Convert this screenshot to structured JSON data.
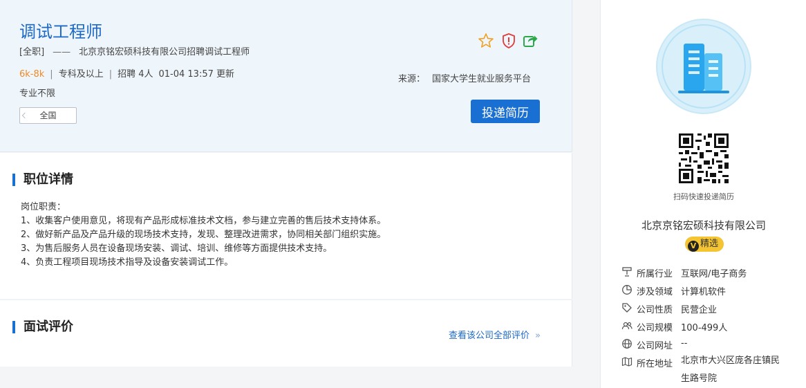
{
  "job": {
    "title": "调试工程师",
    "type": "[全职]",
    "dash": "——",
    "subtitle": "北京京铭宏硕科技有限公司招聘调试工程师",
    "salary": "6k-8k",
    "education": "专科及以上",
    "recruit": "招聘 4人",
    "updated": "01-04 13:57 更新",
    "major": "专业不限",
    "location": "全国",
    "source_label": "来源：",
    "source": "国家大学生就业服务平台",
    "apply_label": "投递简历"
  },
  "icons": {
    "favorite": "star-icon",
    "report": "shield-alert-icon",
    "share": "share-icon"
  },
  "detail": {
    "title": "职位详情",
    "lines": [
      "岗位职责：",
      "1、收集客户使用意见，将现有产品形成标准技术文档，参与建立完善的售后技术支持体系。",
      "2、做好新产品及产品升级的现场技术支持，发现、整理改进需求，协同相关部门组织实施。",
      "3、为售后服务人员在设备现场安装、调试、培训、维修等方面提供技术支持。",
      "4、负责工程项目现场技术指导及设备安装调试工作。"
    ]
  },
  "review": {
    "title": "面试评价",
    "link": "查看该公司全部评价",
    "chevron": "»"
  },
  "company": {
    "qr_label": "扫码快速投递简历",
    "name": "北京京铭宏硕科技有限公司",
    "badge_v": "V",
    "badge": "精选",
    "info": [
      {
        "icon": "industry-icon",
        "key": "所属行业",
        "value": "互联网/电子商务"
      },
      {
        "icon": "pie-chart-icon",
        "key": "涉及领域",
        "value": "计算机软件"
      },
      {
        "icon": "tag-icon",
        "key": "公司性质",
        "value": "民营企业"
      },
      {
        "icon": "people-icon",
        "key": "公司规模",
        "value": "100-499人"
      },
      {
        "icon": "globe-icon",
        "key": "公司网址",
        "value": "--"
      },
      {
        "icon": "map-icon",
        "key": "所在地址",
        "value": "北京市大兴区庞各庄镇民生路号院"
      }
    ]
  },
  "colors": {
    "accent": "#1a6fd2",
    "title_blue": "#1c68c6",
    "salary_orange": "#f08a24",
    "badge_yellow": "#f4c433"
  }
}
